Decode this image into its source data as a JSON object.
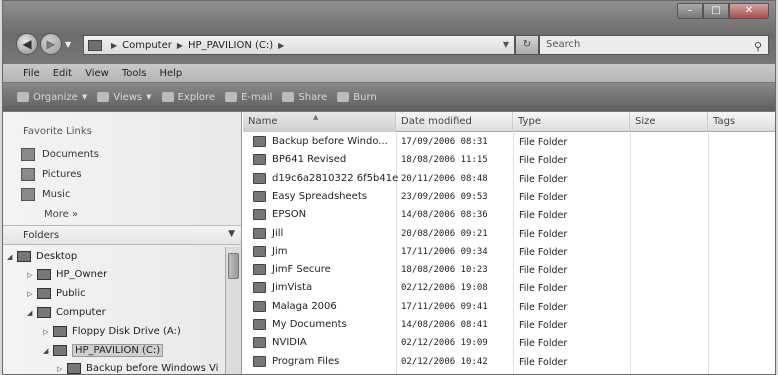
{
  "address": {
    "segments": [
      "Computer",
      "HP_PAVILION (C:)"
    ],
    "search_placeholder": "Search"
  },
  "menu": [
    "File",
    "Edit",
    "View",
    "Tools",
    "Help"
  ],
  "toolbar": {
    "organize": "Organize",
    "views": "Views",
    "explore": "Explore",
    "email": "E-mail",
    "share": "Share",
    "burn": "Burn"
  },
  "nav": {
    "favorites_title": "Favorite Links",
    "favorites": [
      {
        "label": "Documents",
        "icon": "documents-icon"
      },
      {
        "label": "Pictures",
        "icon": "pictures-icon"
      },
      {
        "label": "Music",
        "icon": "music-icon"
      }
    ],
    "more": "More »",
    "folders_title": "Folders",
    "tree": [
      {
        "label": "Desktop",
        "level": 0,
        "expanded": true
      },
      {
        "label": "HP_Owner",
        "level": 1,
        "expanded": false
      },
      {
        "label": "Public",
        "level": 1,
        "expanded": false
      },
      {
        "label": "Computer",
        "level": 1,
        "expanded": true
      },
      {
        "label": "Floppy Disk Drive (A:)",
        "level": 2,
        "expanded": false
      },
      {
        "label": "HP_PAVILION (C:)",
        "level": 2,
        "expanded": true,
        "selected": true
      },
      {
        "label": "Backup before Windows Vi",
        "level": 3,
        "expanded": false
      }
    ]
  },
  "columns": {
    "name": "Name",
    "date": "Date modified",
    "type": "Type",
    "size": "Size",
    "tags": "Tags"
  },
  "files": [
    {
      "name": "Backup before Windo...",
      "date": "17/09/2006 08:31",
      "type": "File Folder"
    },
    {
      "name": "BP641 Revised",
      "date": "18/08/2006 11:15",
      "type": "File Folder"
    },
    {
      "name": "d19c6a2810322 6f5b41e",
      "date": "20/11/2006 08:48",
      "type": "File Folder"
    },
    {
      "name": "Easy Spreadsheets",
      "date": "23/09/2006 09:53",
      "type": "File Folder"
    },
    {
      "name": "EPSON",
      "date": "14/08/2006 08:36",
      "type": "File Folder"
    },
    {
      "name": "Jill",
      "date": "20/08/2006 09:21",
      "type": "File Folder"
    },
    {
      "name": "Jim",
      "date": "17/11/2006 09:34",
      "type": "File Folder"
    },
    {
      "name": "JimF Secure",
      "date": "18/08/2006 10:23",
      "type": "File Folder"
    },
    {
      "name": "JimVista",
      "date": "02/12/2006 19:08",
      "type": "File Folder"
    },
    {
      "name": "Malaga 2006",
      "date": "17/11/2006 09:41",
      "type": "File Folder"
    },
    {
      "name": "My Documents",
      "date": "14/08/2006 08:41",
      "type": "File Folder"
    },
    {
      "name": "NVIDIA",
      "date": "02/12/2006 19:09",
      "type": "File Folder"
    },
    {
      "name": "Program Files",
      "date": "02/12/2006 10:42",
      "type": "File Folder"
    }
  ]
}
